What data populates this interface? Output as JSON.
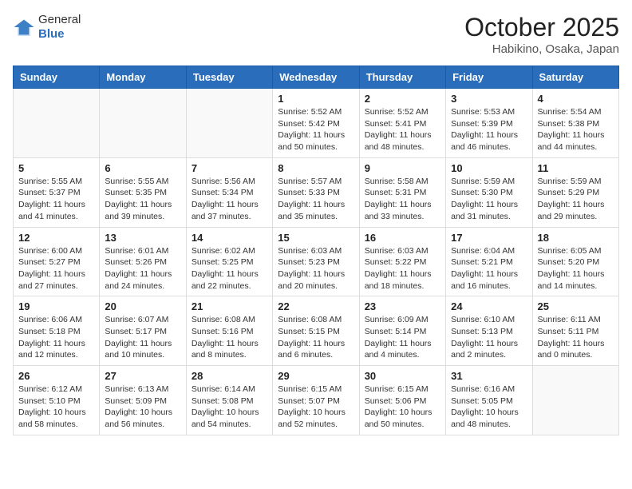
{
  "logo": {
    "general": "General",
    "blue": "Blue"
  },
  "title": "October 2025",
  "subtitle": "Habikino, Osaka, Japan",
  "weekdays": [
    "Sunday",
    "Monday",
    "Tuesday",
    "Wednesday",
    "Thursday",
    "Friday",
    "Saturday"
  ],
  "weeks": [
    [
      {
        "day": "",
        "info": ""
      },
      {
        "day": "",
        "info": ""
      },
      {
        "day": "",
        "info": ""
      },
      {
        "day": "1",
        "info": "Sunrise: 5:52 AM\nSunset: 5:42 PM\nDaylight: 11 hours and 50 minutes."
      },
      {
        "day": "2",
        "info": "Sunrise: 5:52 AM\nSunset: 5:41 PM\nDaylight: 11 hours and 48 minutes."
      },
      {
        "day": "3",
        "info": "Sunrise: 5:53 AM\nSunset: 5:39 PM\nDaylight: 11 hours and 46 minutes."
      },
      {
        "day": "4",
        "info": "Sunrise: 5:54 AM\nSunset: 5:38 PM\nDaylight: 11 hours and 44 minutes."
      }
    ],
    [
      {
        "day": "5",
        "info": "Sunrise: 5:55 AM\nSunset: 5:37 PM\nDaylight: 11 hours and 41 minutes."
      },
      {
        "day": "6",
        "info": "Sunrise: 5:55 AM\nSunset: 5:35 PM\nDaylight: 11 hours and 39 minutes."
      },
      {
        "day": "7",
        "info": "Sunrise: 5:56 AM\nSunset: 5:34 PM\nDaylight: 11 hours and 37 minutes."
      },
      {
        "day": "8",
        "info": "Sunrise: 5:57 AM\nSunset: 5:33 PM\nDaylight: 11 hours and 35 minutes."
      },
      {
        "day": "9",
        "info": "Sunrise: 5:58 AM\nSunset: 5:31 PM\nDaylight: 11 hours and 33 minutes."
      },
      {
        "day": "10",
        "info": "Sunrise: 5:59 AM\nSunset: 5:30 PM\nDaylight: 11 hours and 31 minutes."
      },
      {
        "day": "11",
        "info": "Sunrise: 5:59 AM\nSunset: 5:29 PM\nDaylight: 11 hours and 29 minutes."
      }
    ],
    [
      {
        "day": "12",
        "info": "Sunrise: 6:00 AM\nSunset: 5:27 PM\nDaylight: 11 hours and 27 minutes."
      },
      {
        "day": "13",
        "info": "Sunrise: 6:01 AM\nSunset: 5:26 PM\nDaylight: 11 hours and 24 minutes."
      },
      {
        "day": "14",
        "info": "Sunrise: 6:02 AM\nSunset: 5:25 PM\nDaylight: 11 hours and 22 minutes."
      },
      {
        "day": "15",
        "info": "Sunrise: 6:03 AM\nSunset: 5:23 PM\nDaylight: 11 hours and 20 minutes."
      },
      {
        "day": "16",
        "info": "Sunrise: 6:03 AM\nSunset: 5:22 PM\nDaylight: 11 hours and 18 minutes."
      },
      {
        "day": "17",
        "info": "Sunrise: 6:04 AM\nSunset: 5:21 PM\nDaylight: 11 hours and 16 minutes."
      },
      {
        "day": "18",
        "info": "Sunrise: 6:05 AM\nSunset: 5:20 PM\nDaylight: 11 hours and 14 minutes."
      }
    ],
    [
      {
        "day": "19",
        "info": "Sunrise: 6:06 AM\nSunset: 5:18 PM\nDaylight: 11 hours and 12 minutes."
      },
      {
        "day": "20",
        "info": "Sunrise: 6:07 AM\nSunset: 5:17 PM\nDaylight: 11 hours and 10 minutes."
      },
      {
        "day": "21",
        "info": "Sunrise: 6:08 AM\nSunset: 5:16 PM\nDaylight: 11 hours and 8 minutes."
      },
      {
        "day": "22",
        "info": "Sunrise: 6:08 AM\nSunset: 5:15 PM\nDaylight: 11 hours and 6 minutes."
      },
      {
        "day": "23",
        "info": "Sunrise: 6:09 AM\nSunset: 5:14 PM\nDaylight: 11 hours and 4 minutes."
      },
      {
        "day": "24",
        "info": "Sunrise: 6:10 AM\nSunset: 5:13 PM\nDaylight: 11 hours and 2 minutes."
      },
      {
        "day": "25",
        "info": "Sunrise: 6:11 AM\nSunset: 5:11 PM\nDaylight: 11 hours and 0 minutes."
      }
    ],
    [
      {
        "day": "26",
        "info": "Sunrise: 6:12 AM\nSunset: 5:10 PM\nDaylight: 10 hours and 58 minutes."
      },
      {
        "day": "27",
        "info": "Sunrise: 6:13 AM\nSunset: 5:09 PM\nDaylight: 10 hours and 56 minutes."
      },
      {
        "day": "28",
        "info": "Sunrise: 6:14 AM\nSunset: 5:08 PM\nDaylight: 10 hours and 54 minutes."
      },
      {
        "day": "29",
        "info": "Sunrise: 6:15 AM\nSunset: 5:07 PM\nDaylight: 10 hours and 52 minutes."
      },
      {
        "day": "30",
        "info": "Sunrise: 6:15 AM\nSunset: 5:06 PM\nDaylight: 10 hours and 50 minutes."
      },
      {
        "day": "31",
        "info": "Sunrise: 6:16 AM\nSunset: 5:05 PM\nDaylight: 10 hours and 48 minutes."
      },
      {
        "day": "",
        "info": ""
      }
    ]
  ]
}
